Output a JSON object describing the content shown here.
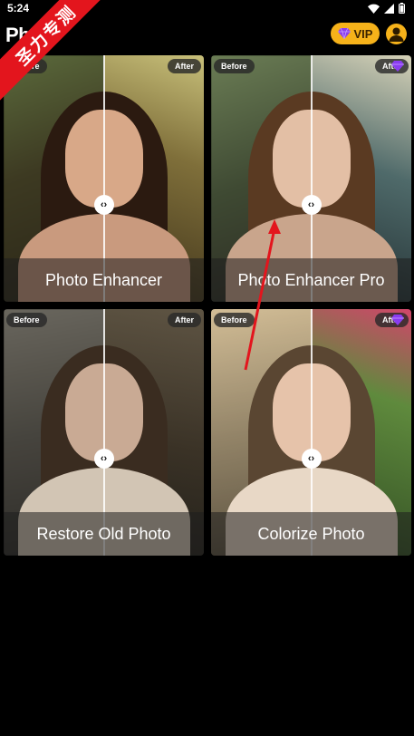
{
  "status_bar": {
    "time": "5:24"
  },
  "app_bar": {
    "title": "Photo",
    "vip_label": "VIP"
  },
  "watermark": {
    "text": "圣力专测"
  },
  "cards": [
    {
      "title": "Photo Enhancer",
      "before": "Before",
      "after": "After",
      "pro_badge": false
    },
    {
      "title": "Photo Enhancer Pro",
      "before": "Before",
      "after": "After",
      "pro_badge": true
    },
    {
      "title": "Restore Old Photo",
      "before": "Before",
      "after": "After",
      "pro_badge": false
    },
    {
      "title": "Colorize Photo",
      "before": "Before",
      "after": "After",
      "pro_badge": true
    }
  ],
  "colors": {
    "accent": "#f6b21a",
    "watermark": "#e3151d",
    "annotation_arrow": "#e3151d"
  }
}
